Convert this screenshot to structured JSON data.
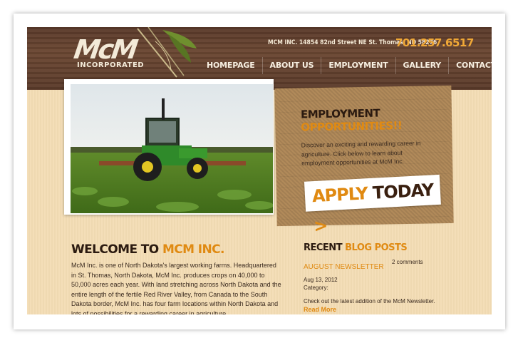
{
  "header": {
    "logo_text": "McM",
    "logo_sub": "INCORPORATED",
    "address": "MCM INC. 14854 82nd Street NE St. Thomas, ND 58276",
    "phone": "701.257.6517"
  },
  "nav": {
    "items": [
      "HOMEPAGE",
      "ABOUT US",
      "EMPLOYMENT",
      "GALLERY",
      "CONTACT US"
    ]
  },
  "employment": {
    "title": "EMPLOYMENT",
    "subtitle": "OPPORTUNITIES!!",
    "text": "Discover an exciting and rewarding career in agriculture. Click below to learn about employment opportunities at McM Inc.",
    "apply_word1": "APPLY",
    "apply_word2": "TODAY",
    "apply_arrow": ">"
  },
  "welcome": {
    "title_1": "WELCOME TO",
    "title_2": "MCM INC.",
    "text": "McM Inc. is one of North Dakota's largest working farms. Headquartered in St. Thomas, North Dakota, McM Inc. produces crops on 40,000 to 50,000 acres each year. With land stretching across North Dakota and the entire length of the fertile Red River Valley, from Canada to the South Dakota border, McM Inc. has four farm locations within North Dakota and lots of possibilities for a rewarding career in agriculture."
  },
  "blog": {
    "title_1": "RECENT",
    "title_2": "BLOG POSTS",
    "post_title": "AUGUST NEWSLETTER",
    "comments": "2 comments",
    "date": "Aug 13, 2012",
    "category": "Category:",
    "text": "Check out the latest addition of the McM Newsletter.",
    "read_more": "Read More"
  },
  "colors": {
    "accent": "#e08a12",
    "dark_text": "#2b1a10",
    "wood": "#5a3a2a",
    "background": "#f3dcb4"
  }
}
